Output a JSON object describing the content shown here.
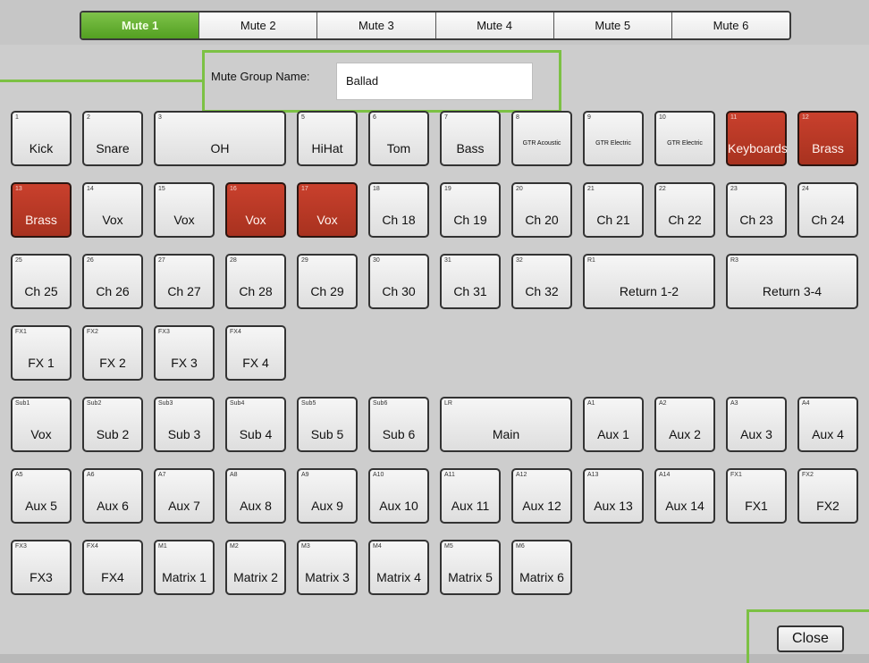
{
  "tabs": [
    {
      "label": "Mute 1",
      "active": true
    },
    {
      "label": "Mute 2",
      "active": false
    },
    {
      "label": "Mute 3",
      "active": false
    },
    {
      "label": "Mute 4",
      "active": false
    },
    {
      "label": "Mute 5",
      "active": false
    },
    {
      "label": "Mute 6",
      "active": false
    }
  ],
  "mute_group": {
    "name_label": "Mute Group Name:",
    "name_value": "Ballad"
  },
  "colors": {
    "muted": "#b5392a",
    "accent_green": "#7cc144",
    "tab_active": "#6cb33a"
  },
  "rows": [
    [
      {
        "num": "1",
        "label": "Kick"
      },
      {
        "num": "2",
        "label": "Snare"
      },
      {
        "num": "3",
        "label": "OH"
      },
      {
        "num": "5",
        "label": "HiHat"
      },
      {
        "num": "6",
        "label": "Tom"
      },
      {
        "num": "7",
        "label": "Bass"
      },
      {
        "num": "8",
        "label": "GTR Acoustic"
      },
      {
        "num": "9",
        "label": "GTR Electric"
      },
      {
        "num": "10",
        "label": "GTR Electric"
      },
      {
        "num": "11",
        "label": "Keyboards",
        "muted": true
      },
      {
        "num": "12",
        "label": "Brass",
        "muted": true
      }
    ],
    [
      {
        "num": "13",
        "label": "Brass",
        "muted": true
      },
      {
        "num": "14",
        "label": "Vox"
      },
      {
        "num": "15",
        "label": "Vox"
      },
      {
        "num": "16",
        "label": "Vox",
        "muted": true
      },
      {
        "num": "17",
        "label": "Vox",
        "muted": true
      },
      {
        "num": "18",
        "label": "Ch 18"
      },
      {
        "num": "19",
        "label": "Ch 19"
      },
      {
        "num": "20",
        "label": "Ch 20"
      },
      {
        "num": "21",
        "label": "Ch 21"
      },
      {
        "num": "22",
        "label": "Ch 22"
      },
      {
        "num": "23",
        "label": "Ch 23"
      },
      {
        "num": "24",
        "label": "Ch 24"
      }
    ],
    [
      {
        "num": "25",
        "label": "Ch 25"
      },
      {
        "num": "26",
        "label": "Ch 26"
      },
      {
        "num": "27",
        "label": "Ch 27"
      },
      {
        "num": "28",
        "label": "Ch 28"
      },
      {
        "num": "29",
        "label": "Ch 29"
      },
      {
        "num": "30",
        "label": "Ch 30"
      },
      {
        "num": "31",
        "label": "Ch 31"
      },
      {
        "num": "32",
        "label": "Ch 32"
      },
      {
        "num": "R1",
        "label": "Return 1-2"
      },
      {
        "num": "R3",
        "label": "Return 3-4"
      }
    ],
    [
      {
        "num": "FX1",
        "label": "FX 1"
      },
      {
        "num": "FX2",
        "label": "FX 2"
      },
      {
        "num": "FX3",
        "label": "FX 3"
      },
      {
        "num": "FX4",
        "label": "FX 4"
      }
    ],
    [
      {
        "num": "Sub1",
        "label": "Vox"
      },
      {
        "num": "Sub2",
        "label": "Sub 2"
      },
      {
        "num": "Sub3",
        "label": "Sub 3"
      },
      {
        "num": "Sub4",
        "label": "Sub 4"
      },
      {
        "num": "Sub5",
        "label": "Sub 5"
      },
      {
        "num": "Sub6",
        "label": "Sub 6"
      },
      {
        "num": "LR",
        "label": "Main"
      },
      {
        "num": "A1",
        "label": "Aux 1"
      },
      {
        "num": "A2",
        "label": "Aux 2"
      },
      {
        "num": "A3",
        "label": "Aux 3"
      },
      {
        "num": "A4",
        "label": "Aux 4"
      }
    ],
    [
      {
        "num": "A5",
        "label": "Aux 5"
      },
      {
        "num": "A6",
        "label": "Aux 6"
      },
      {
        "num": "A7",
        "label": "Aux 7"
      },
      {
        "num": "A8",
        "label": "Aux 8"
      },
      {
        "num": "A9",
        "label": "Aux 9"
      },
      {
        "num": "A10",
        "label": "Aux 10"
      },
      {
        "num": "A11",
        "label": "Aux 11"
      },
      {
        "num": "A12",
        "label": "Aux 12"
      },
      {
        "num": "A13",
        "label": "Aux 13"
      },
      {
        "num": "A14",
        "label": "Aux 14"
      },
      {
        "num": "FX1",
        "label": "FX1"
      },
      {
        "num": "FX2",
        "label": "FX2"
      }
    ],
    [
      {
        "num": "FX3",
        "label": "FX3"
      },
      {
        "num": "FX4",
        "label": "FX4"
      },
      {
        "num": "M1",
        "label": "Matrix 1"
      },
      {
        "num": "M2",
        "label": "Matrix 2"
      },
      {
        "num": "M3",
        "label": "Matrix 3"
      },
      {
        "num": "M4",
        "label": "Matrix 4"
      },
      {
        "num": "M5",
        "label": "Matrix 5"
      },
      {
        "num": "M6",
        "label": "Matrix 6"
      }
    ]
  ],
  "close_label": "Close"
}
